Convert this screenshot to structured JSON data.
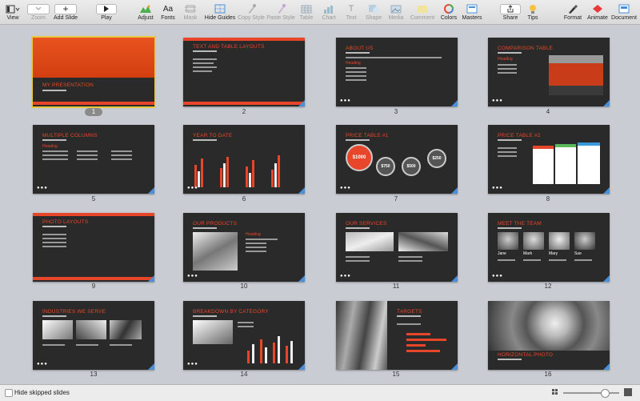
{
  "toolbar": {
    "view": "View",
    "zoom": "Zoom",
    "add_slide": "Add Slide",
    "play": "Play",
    "adjust": "Adjust",
    "fonts": "Fonts",
    "mask": "Mask",
    "hide_guides": "Hide Guides",
    "copy_style": "Copy Style",
    "paste_style": "Paste Style",
    "table": "Table",
    "chart": "Chart",
    "text": "Text",
    "shape": "Shape",
    "media": "Media",
    "comment": "Comment",
    "colors": "Colors",
    "masters": "Masters",
    "share": "Share",
    "tips": "Tips",
    "format": "Format",
    "animate": "Animate",
    "document": "Document",
    "fonts_glyph": "Aa",
    "text_glyph": "T",
    "add_glyph": "+"
  },
  "slides": [
    {
      "num": "1",
      "title": "MY PRESENTATION"
    },
    {
      "num": "2",
      "title": "TEXT AND TABLE LAYOUTS"
    },
    {
      "num": "3",
      "title": "ABOUT US"
    },
    {
      "num": "4",
      "title": "COMPARISON TABLE"
    },
    {
      "num": "5",
      "title": "MULTIPLE COLUMNS"
    },
    {
      "num": "6",
      "title": "YEAR TO DATE"
    },
    {
      "num": "7",
      "title": "PRICE TABLE #1"
    },
    {
      "num": "8",
      "title": "PRICE TABLE #2"
    },
    {
      "num": "9",
      "title": "PHOTO LAYOUTS"
    },
    {
      "num": "10",
      "title": "OUR PRODUCTS"
    },
    {
      "num": "11",
      "title": "OUR SERVICES"
    },
    {
      "num": "12",
      "title": "MEET THE TEAM"
    },
    {
      "num": "13",
      "title": "INDUSTRIES WE SERVE"
    },
    {
      "num": "14",
      "title": "BREAKDOWN BY CATEGORY"
    },
    {
      "num": "15",
      "title": "TARGETS"
    },
    {
      "num": "16",
      "title": "HORIZONTAL PHOTO"
    }
  ],
  "slide_text": {
    "heading": "Heading",
    "dots": "●●●",
    "prices": [
      "$1000",
      "$750",
      "$500",
      "$250"
    ],
    "team": [
      "Jane",
      "Mark",
      "Mary",
      "Sue"
    ]
  },
  "statusbar": {
    "hide_skipped": "Hide skipped slides"
  }
}
